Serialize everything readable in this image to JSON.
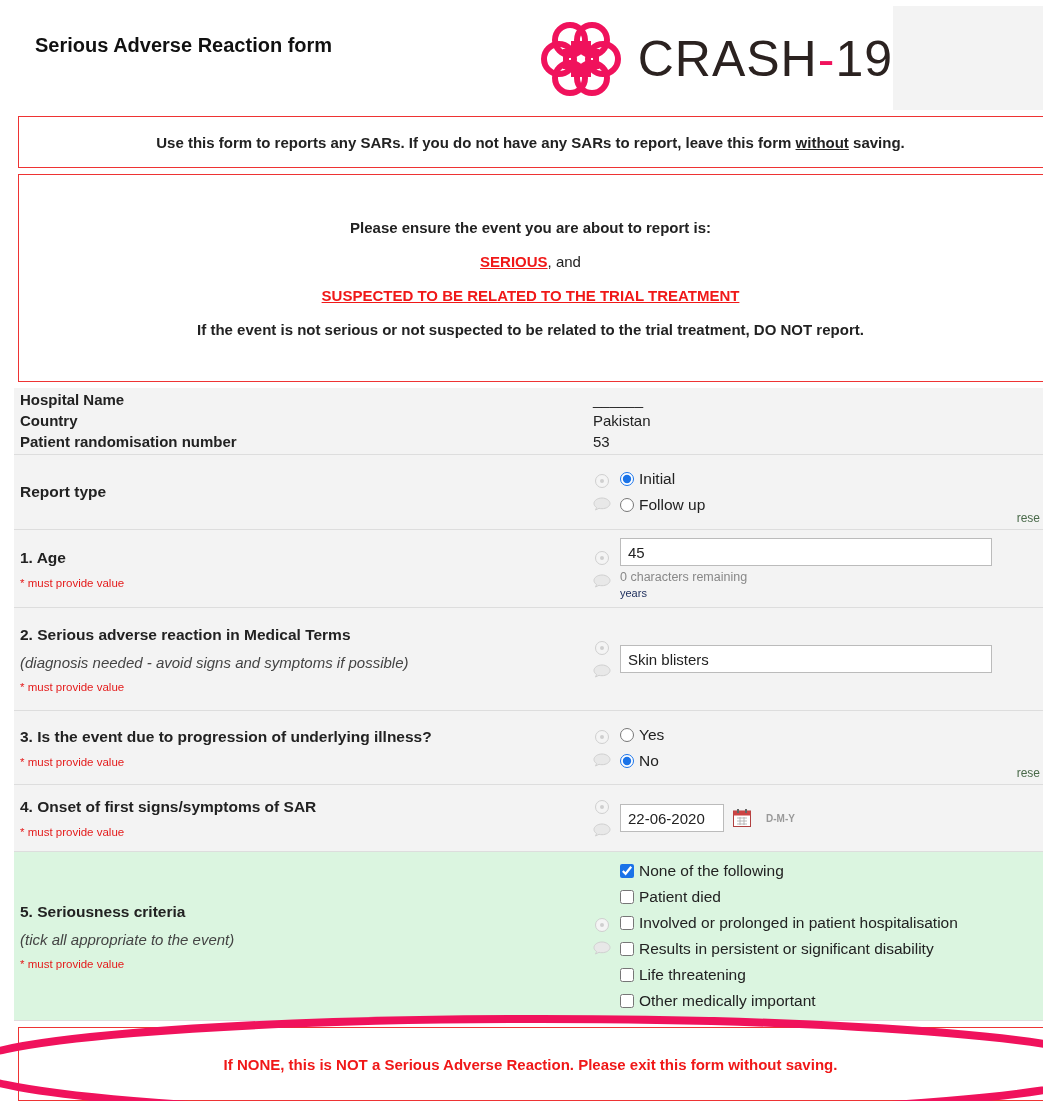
{
  "header": {
    "title": "Serious Adverse Reaction form",
    "logo": {
      "word": "CRASH",
      "dash": "-",
      "number": "19"
    }
  },
  "notice": {
    "before": "Use this form to reports any SARs. If you do not have any SARs to report, leave this form ",
    "underlined": "without",
    "after": " saving."
  },
  "warning": {
    "lines": [
      {
        "kind": "plain",
        "text": "Please ensure the event you are about to report is:"
      },
      {
        "kind": "emphasis",
        "text": "SERIOUS",
        "suffix": ", and"
      },
      {
        "kind": "emphasis",
        "text": "SUSPECTED TO BE RELATED TO THE TRIAL TREATMENT"
      },
      {
        "kind": "plain",
        "text": "If the event is not serious or not suspected to be related to the trial treatment, DO NOT report."
      }
    ]
  },
  "info": [
    {
      "label": "Hospital Name",
      "value": "______"
    },
    {
      "label": "Country",
      "value": "Pakistan"
    },
    {
      "label": "Patient randomisation number",
      "value": "53"
    }
  ],
  "questions": [
    {
      "kind": "radio",
      "label": "Report type",
      "highlighted": false,
      "options": [
        {
          "label": "Initial",
          "selected": true
        },
        {
          "label": "Follow up",
          "selected": false
        }
      ],
      "reset": "rese"
    },
    {
      "kind": "text",
      "label": "1. Age",
      "highlighted": false,
      "required": "* must provide value",
      "value": "45",
      "counter": "0 characters remaining",
      "unit": "years"
    },
    {
      "kind": "text",
      "label": "2. Serious adverse reaction in Medical Terms",
      "highlighted": false,
      "note": "(diagnosis needed - avoid signs and symptoms if possible)",
      "required": "* must provide value",
      "value": "Skin blisters"
    },
    {
      "kind": "radio",
      "label": "3. Is the event due to progression of underlying illness?",
      "highlighted": false,
      "required": "* must provide value",
      "options": [
        {
          "label": "Yes",
          "selected": false
        },
        {
          "label": "No",
          "selected": true
        }
      ],
      "reset": "rese"
    },
    {
      "kind": "date",
      "label": "4. Onset of first signs/symptoms of SAR",
      "highlighted": false,
      "required": "* must provide value",
      "value": "22-06-2020",
      "format": "D-M-Y"
    },
    {
      "kind": "checkboxes",
      "label": "5. Seriousness criteria",
      "highlighted": true,
      "note": "(tick all appropriate to the event)",
      "required": "* must provide value",
      "options": [
        {
          "label": "None of the following",
          "checked": true
        },
        {
          "label": "Patient died",
          "checked": false
        },
        {
          "label": "Involved or prolonged in patient hospitalisation",
          "checked": false
        },
        {
          "label": "Results in persistent or significant disability",
          "checked": false
        },
        {
          "label": "Life threatening",
          "checked": false
        },
        {
          "label": "Other medically important",
          "checked": false
        }
      ]
    }
  ],
  "exit_notice": "If NONE, this is NOT a Serious Adverse Reaction. Please exit this form without saving."
}
